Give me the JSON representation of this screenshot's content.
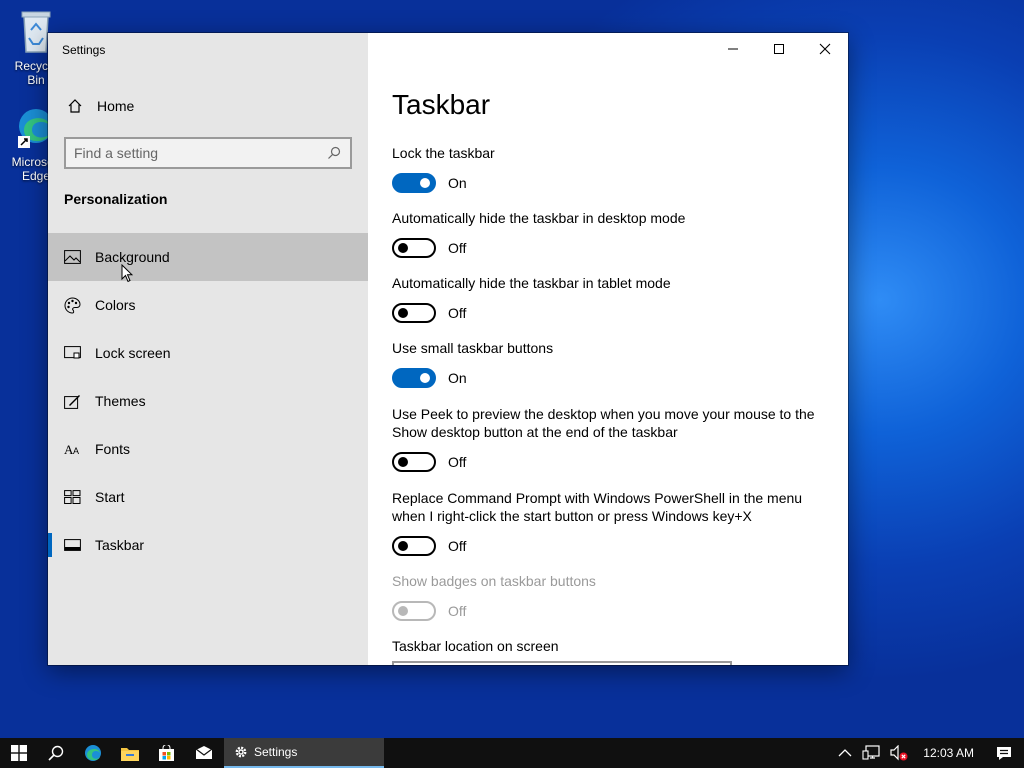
{
  "desktop": {
    "icons": [
      {
        "label": "Recycle Bin",
        "icon": "recycle-bin-icon"
      },
      {
        "label": "Microsoft Edge",
        "icon": "edge-icon"
      }
    ]
  },
  "window": {
    "title": "Settings",
    "controls": {
      "minimize": "minimize-icon",
      "maximize": "maximize-icon",
      "close": "close-icon"
    }
  },
  "sidebar": {
    "home_label": "Home",
    "search_placeholder": "Find a setting",
    "section_title": "Personalization",
    "items": [
      {
        "label": "Background",
        "icon": "picture-icon",
        "state": "hover"
      },
      {
        "label": "Colors",
        "icon": "palette-icon"
      },
      {
        "label": "Lock screen",
        "icon": "lock-screen-icon"
      },
      {
        "label": "Themes",
        "icon": "themes-icon"
      },
      {
        "label": "Fonts",
        "icon": "fonts-icon"
      },
      {
        "label": "Start",
        "icon": "start-icon"
      },
      {
        "label": "Taskbar",
        "icon": "taskbar-icon",
        "state": "selected"
      }
    ]
  },
  "main": {
    "title": "Taskbar",
    "settings": [
      {
        "label": "Lock the taskbar",
        "value": "On",
        "on": true
      },
      {
        "label": "Automatically hide the taskbar in desktop mode",
        "value": "Off",
        "on": false
      },
      {
        "label": "Automatically hide the taskbar in tablet mode",
        "value": "Off",
        "on": false
      },
      {
        "label": "Use small taskbar buttons",
        "value": "On",
        "on": true
      },
      {
        "label": "Use Peek to preview the desktop when you move your mouse to the Show desktop button at the end of the taskbar",
        "value": "Off",
        "on": false
      },
      {
        "label": "Replace Command Prompt with Windows PowerShell in the menu when I right-click the start button or press Windows key+X",
        "value": "Off",
        "on": false
      },
      {
        "label": "Show badges on taskbar buttons",
        "value": "Off",
        "on": false,
        "disabled": true
      }
    ],
    "location_label": "Taskbar location on screen"
  },
  "taskbar": {
    "active_app": "Settings",
    "clock": "12:03 AM"
  },
  "colors": {
    "accent": "#0067c0",
    "sidebar_bg": "#e6e6e6",
    "hover_bg": "#c3c3c3",
    "taskbar_bg": "#101010"
  }
}
